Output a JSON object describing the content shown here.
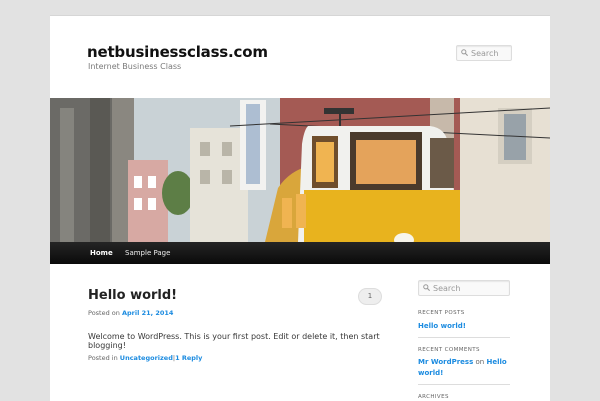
{
  "header": {
    "site_title": "netbusinessclass.com",
    "site_description": "Internet Business Class",
    "search_placeholder": "Search"
  },
  "nav": {
    "items": [
      {
        "label": "Home"
      },
      {
        "label": "Sample Page"
      }
    ]
  },
  "post": {
    "title": "Hello world!",
    "comment_count": "1",
    "posted_on_label": "Posted on",
    "date": "April 21, 2014",
    "content": "Welcome to WordPress. This is your first post. Edit or delete it, then start blogging!",
    "posted_in_label": "Posted in",
    "category": "Uncategorized",
    "separator": "|",
    "reply_link": "1 Reply"
  },
  "sidebar": {
    "search_placeholder": "Search",
    "recent_posts_title": "RECENT POSTS",
    "recent_post": "Hello world!",
    "recent_comments_title": "RECENT COMMENTS",
    "comment_author": "Mr WordPress",
    "comment_on": "on",
    "comment_post": "Hello world!",
    "archives_title": "ARCHIVES"
  }
}
